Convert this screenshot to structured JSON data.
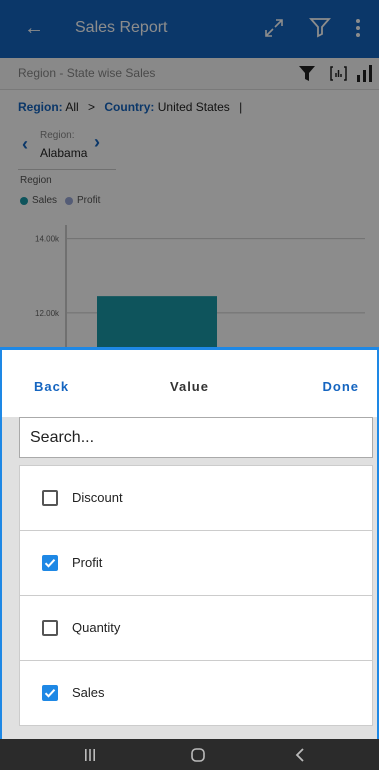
{
  "appbar": {
    "title": "Sales Report",
    "icons": [
      "back-arrow-icon",
      "expand-icon",
      "filter-icon",
      "more-vert-icon"
    ]
  },
  "subbar": {
    "title": "Region - State wise Sales",
    "icons": [
      "funnel-icon",
      "table-icon",
      "bar-chart-icon"
    ]
  },
  "breadcrumb": {
    "region_key": "Region:",
    "region_value": "All",
    "separator": ">",
    "country_key": "Country:",
    "country_value": "United States",
    "end": "|"
  },
  "region_chip": {
    "label": "Region:",
    "value": "Alabama"
  },
  "chart": {
    "caption": "Region",
    "legend": [
      {
        "name": "Sales",
        "color": "#1a9aa8"
      },
      {
        "name": "Profit",
        "color": "#9aa8d8"
      }
    ]
  },
  "chart_data": {
    "type": "bar",
    "series": [
      {
        "name": "Sales",
        "values": [
          12450
        ]
      },
      {
        "name": "Profit",
        "values": []
      }
    ],
    "y_ticks": [
      "14.00k",
      "12.00k"
    ],
    "ylim": [
      11000,
      14500
    ]
  },
  "sheet": {
    "back": "Back",
    "title": "Value",
    "done": "Done",
    "search_placeholder": "Search...",
    "items": [
      {
        "label": "Discount",
        "checked": false
      },
      {
        "label": "Profit",
        "checked": true
      },
      {
        "label": "Quantity",
        "checked": false
      },
      {
        "label": "Sales",
        "checked": true
      }
    ]
  },
  "colors": {
    "primary": "#1565c0",
    "accent": "#1e88e5",
    "sales_bar": "#1a9aa8"
  },
  "navbar": {
    "icons": [
      "recents-icon",
      "home-icon",
      "back-nav-icon"
    ]
  }
}
